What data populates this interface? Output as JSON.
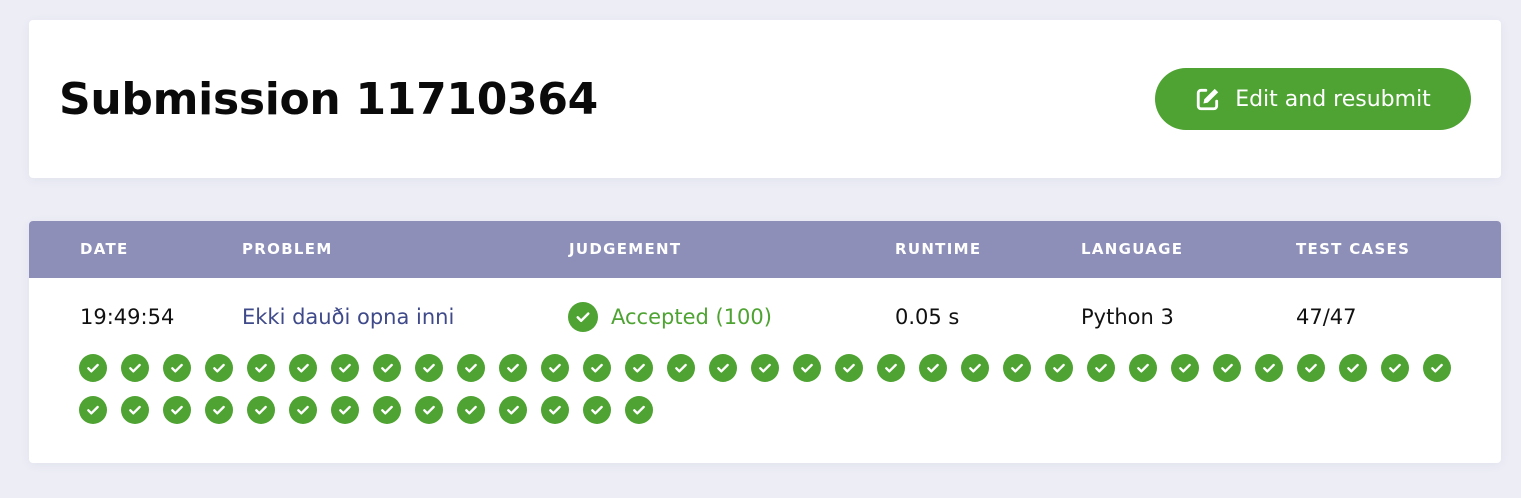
{
  "header": {
    "title": "Submission 11710364",
    "resubmit_label": "Edit and resubmit"
  },
  "table": {
    "columns": [
      "DATE",
      "PROBLEM",
      "JUDGEMENT",
      "RUNTIME",
      "LANGUAGE",
      "TEST CASES"
    ],
    "row": {
      "date": "19:49:54",
      "problem": "Ekki dauði opna inni",
      "judgement": "Accepted (100)",
      "runtime": "0.05 s",
      "language": "Python 3",
      "test_cases": "47/47"
    }
  },
  "test_case_results": {
    "total": 47,
    "passed": 47,
    "status": "accepted"
  },
  "colors": {
    "accent_green": "#4ea332",
    "table_header": "#8d8fb8",
    "link": "#3f4a8a",
    "background": "#ecedf5"
  },
  "icons": {
    "resubmit": "edit-icon",
    "judgement": "check-circle-icon",
    "test_case": "check-circle-icon"
  }
}
